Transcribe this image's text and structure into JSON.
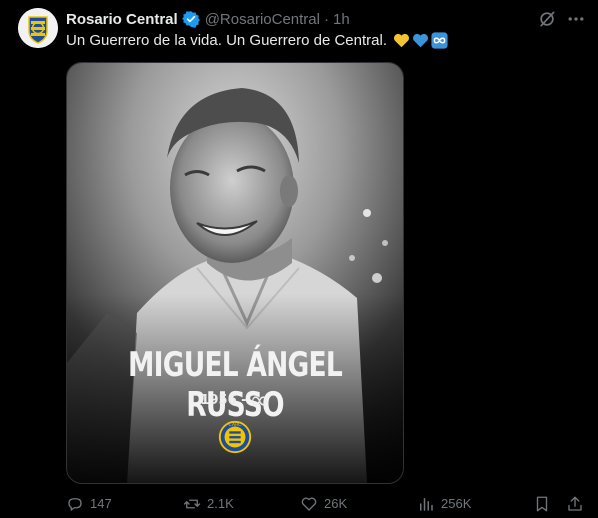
{
  "tweet": {
    "author_name": "Rosario Central",
    "handle": "@RosarioCentral",
    "separator": "·",
    "time": "1h",
    "text": "Un Guerrero de la vida. Un Guerrero de Central.",
    "emojis": [
      "yellow-heart",
      "blue-heart",
      "infinity"
    ]
  },
  "media": {
    "headline": "MIGUEL ÁNGEL RUSSO",
    "years_start": "1956 -",
    "years_end_symbol": "∞",
    "crest_letters": "CARC"
  },
  "actions": {
    "replies": "147",
    "reposts": "2.1K",
    "likes": "26K",
    "views": "256K"
  },
  "colors": {
    "background": "#000000",
    "text": "#e7e9ea",
    "muted": "#71767b",
    "verified": "#1d9bf0",
    "crest_yellow": "#f2c300",
    "crest_blue": "#1d4e9e"
  }
}
